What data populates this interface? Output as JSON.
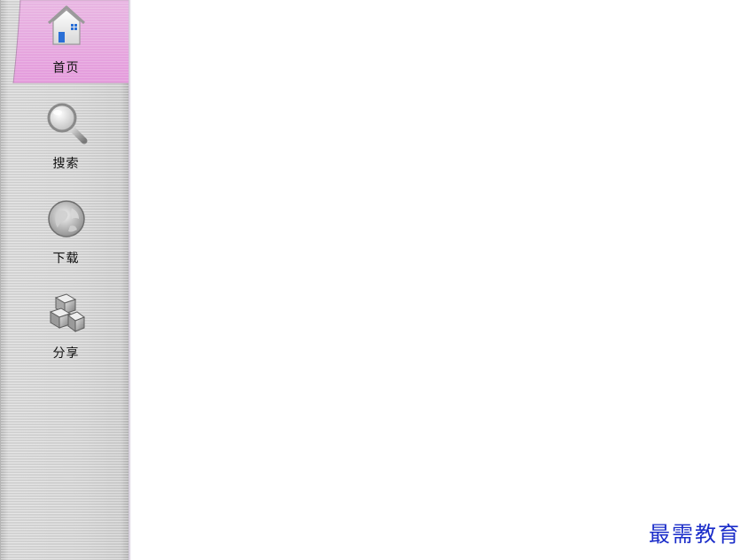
{
  "sidebar": {
    "items": [
      {
        "label": "首页",
        "icon": "home-icon",
        "active": true
      },
      {
        "label": "搜索",
        "icon": "search-icon",
        "active": false
      },
      {
        "label": "下载",
        "icon": "globe-icon",
        "active": false
      },
      {
        "label": "分享",
        "icon": "cubes-icon",
        "active": false
      }
    ]
  },
  "watermark": {
    "text": "最需教育"
  },
  "colors": {
    "active_tab": "#e7a4df",
    "sidebar_bg": "#d6d6d6",
    "watermark": "#1a2cc9"
  }
}
